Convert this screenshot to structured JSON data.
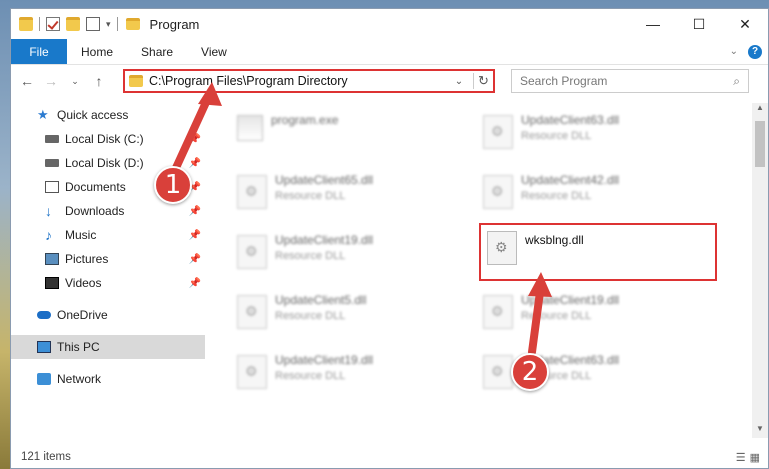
{
  "window": {
    "title": "Program"
  },
  "ribbon": {
    "file": "File",
    "tabs": [
      "Home",
      "Share",
      "View"
    ],
    "help": "?"
  },
  "address": {
    "path": "C:\\Program Files\\Program Directory"
  },
  "search": {
    "placeholder": "Search Program"
  },
  "sidebar": {
    "quick_access": "Quick access",
    "items": [
      "Local Disk (C:)",
      "Local Disk (D:)",
      "Documents",
      "Downloads",
      "Music",
      "Pictures",
      "Videos"
    ],
    "onedrive": "OneDrive",
    "this_pc": "This PC",
    "network": "Network"
  },
  "files": [
    {
      "name": "program.exe",
      "type": ""
    },
    {
      "name": "UpdateClient63.dll",
      "type": "Resource DLL"
    },
    {
      "name": "UpdateClient65.dll",
      "type": "Resource DLL"
    },
    {
      "name": "UpdateClient42.dll",
      "type": "Resource DLL"
    },
    {
      "name": "UpdateClient19.dll",
      "type": "Resource DLL"
    },
    {
      "name": "wksblng.dll",
      "type": ""
    },
    {
      "name": "UpdateClient5.dll",
      "type": "Resource DLL"
    },
    {
      "name": "UpdateClient19.dll",
      "type": "Resource DLL"
    },
    {
      "name": "UpdateClient19.dll",
      "type": "Resource DLL"
    },
    {
      "name": "UpdateClient63.dll",
      "type": "Resource DLL"
    }
  ],
  "status": {
    "count": "121 items"
  },
  "callouts": {
    "one": "1",
    "two": "2"
  },
  "colors": {
    "accent": "#1979ca",
    "highlight": "#dd3333",
    "callout": "#d9403a"
  }
}
